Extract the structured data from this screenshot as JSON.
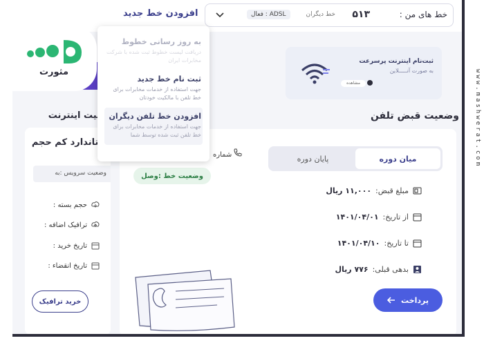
{
  "topbar": {
    "my_lines_label": "خط های من :",
    "line_number": "۵۱۳",
    "other_line_label": "خط دیگران",
    "line_badge": "ADSL : فعال",
    "add_line_link": "افزودن خط جدید"
  },
  "dropdown": {
    "items": [
      {
        "title": "به روز رسانی خطوط",
        "desc": "دریافت لیست خطوط ثبت شده با شرکت مخابرات ایران"
      },
      {
        "title": "ثبت نام خط جدید",
        "desc": "جهت استفاده از خدمات مخابرات برای خط تلفن با مالکیت خودتان"
      },
      {
        "title": "افزودن خط تلفن دیگران",
        "desc": "جهت استفاده از خدمات مخابرات برای خط تلفن ثبت شده توسط شما"
      }
    ]
  },
  "logo": {
    "text": "مثورت"
  },
  "promo": {
    "title": "ثبت‌نام اینترنت پرسرعت",
    "subtitle": "به صورت آنـــــلاین",
    "pill": "مشاهده"
  },
  "bill": {
    "section_title": "وضعیت قبض تلفن",
    "tabs": [
      "میان دوره",
      "پایان دوره"
    ],
    "phone_label": "شماره",
    "line_status": "وضعیت خط :وصل",
    "rows": [
      {
        "label": "مبلغ قبض:",
        "value": "۱۱,۰۰۰ ریال"
      },
      {
        "label": "از تاریخ:",
        "value": "۱۴۰۱/۰۴/۰۱"
      },
      {
        "label": "تا تاریخ:",
        "value": "۱۴۰۱/۰۴/۱۰"
      },
      {
        "label": "بدهی قبلی:",
        "value": "۷۷۶ ریال"
      }
    ],
    "pay_button": "پرداخت"
  },
  "internet": {
    "section_title": "وضعیت اینترنت",
    "card_title": "استاندارد کم حجم",
    "service_status": "وضعیت سرویس :به",
    "rows": [
      "حجم بسته :",
      "ترافیک اضافه :",
      "تاریخ خرید :",
      "تاریخ انقضاء :"
    ],
    "buy_button": "خرید ترافیک"
  },
  "watermark": "www.mashwerat.com",
  "colors": {
    "accent": "#4b5de0",
    "brand": "#3b3f8c",
    "success": "#2a7d42",
    "logo_green": "#2bb673"
  }
}
